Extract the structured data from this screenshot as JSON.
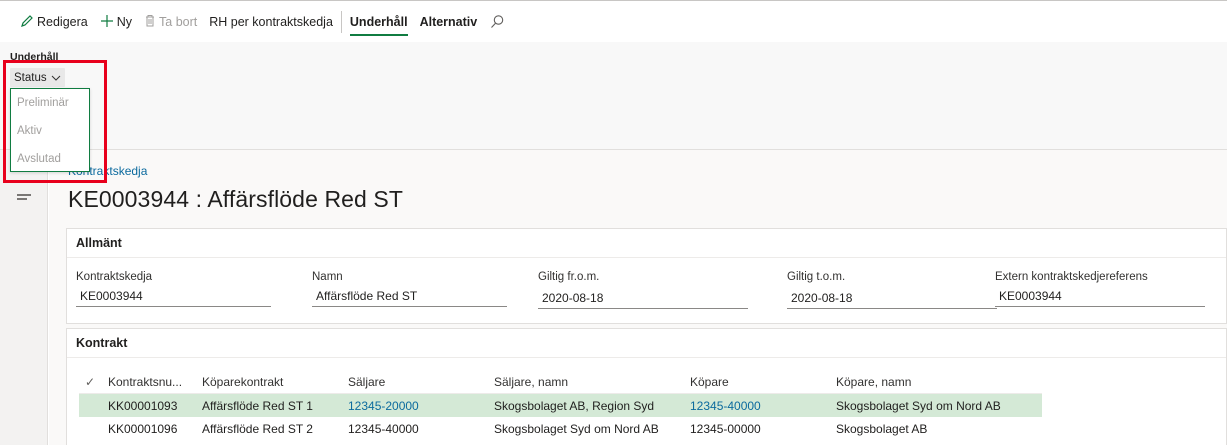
{
  "actionbar": {
    "edit": "Redigera",
    "new": "Ny",
    "delete": "Ta bort",
    "rh_per_chain": "RH per kontraktskedja",
    "maintenance_tab": "Underhåll",
    "options_tab": "Alternativ"
  },
  "ribbon": {
    "group_title": "Underhåll",
    "status_button": "Status",
    "status_menu": [
      "Preliminär",
      "Aktiv",
      "Avslutad"
    ]
  },
  "breadcrumb": "Kontraktskedja",
  "page_title": "KE0003944 : Affärsflöde Red ST",
  "general": {
    "header": "Allmänt",
    "fields": [
      {
        "label": "Kontraktskedja",
        "value": "KE0003944"
      },
      {
        "label": "Namn",
        "value": "Affärsflöde Red ST"
      },
      {
        "label": "Giltig fr.o.m.",
        "value": "2020-08-18"
      },
      {
        "label": "Giltig t.o.m.",
        "value": "2020-08-18"
      },
      {
        "label": "Extern kontraktskedjereferens",
        "value": "KE0003944"
      }
    ]
  },
  "contracts": {
    "header": "Kontrakt",
    "columns": [
      "Kontraktsnu...",
      "Köparekontrakt",
      "Säljare",
      "Säljare, namn",
      "Köpare",
      "Köpare, namn"
    ],
    "rows": [
      [
        "KK00001093",
        "Affärsflöde Red ST 1",
        "12345-20000",
        "Skogsbolaget AB, Region Syd",
        "12345-40000",
        "Skogsbolaget Syd om Nord AB"
      ],
      [
        "KK00001096",
        "Affärsflöde Red ST 2",
        "12345-40000",
        "Skogsbolaget Syd om Nord AB",
        "12345-00000",
        "Skogsbolaget AB"
      ]
    ]
  },
  "colors": {
    "accent": "#107c41",
    "link": "#0b6a9e",
    "selected_row": "#d4e9d6",
    "highlight": "#e8001c"
  }
}
